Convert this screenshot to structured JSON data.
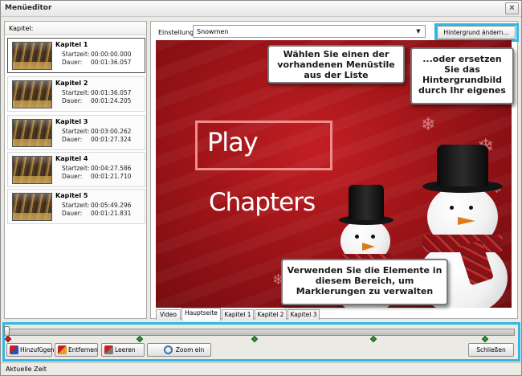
{
  "window": {
    "title": "Menüeditor",
    "close_glyph": "✕"
  },
  "chapters_panel": {
    "header": "Kapitel:",
    "start_label": "Startzeit:",
    "duration_label": "Dauer:",
    "items": [
      {
        "name": "Kapitel 1",
        "start": "00:00:00.000",
        "duration": "00:01:36.057",
        "selected": true
      },
      {
        "name": "Kapitel 2",
        "start": "00:01:36.057",
        "duration": "00:01:24.205",
        "selected": false
      },
      {
        "name": "Kapitel 3",
        "start": "00:03:00.262",
        "duration": "00:01:27.324",
        "selected": false
      },
      {
        "name": "Kapitel 4",
        "start": "00:04:27.586",
        "duration": "00:01:21.710",
        "selected": false
      },
      {
        "name": "Kapitel 5",
        "start": "00:05:49.296",
        "duration": "00:01:21.831",
        "selected": false
      }
    ]
  },
  "settings": {
    "label": "Einstellung",
    "selected_style": "Snowmen",
    "change_background_button": "Hintergrund ändern..."
  },
  "preview": {
    "play_text": "Play",
    "chapters_text": "Chapters"
  },
  "tabs": [
    {
      "label": "Video",
      "active": false
    },
    {
      "label": "Hauptseite",
      "active": true
    },
    {
      "label": "Kapitel 1",
      "active": false
    },
    {
      "label": "Kapitel 2",
      "active": false
    },
    {
      "label": "Kapitel 3",
      "active": false
    }
  ],
  "timeline": {
    "buttons": {
      "add": "Hinzufügen",
      "remove": "Entfernen",
      "clear": "Leeren",
      "zoom": "Zoom ein",
      "close": "Schließen"
    }
  },
  "statusbar": {
    "text": "Aktuelle Zeit"
  },
  "callouts": {
    "style_list": "Wählen Sie einen der vorhandenen Menüstile aus der Liste",
    "background": "...oder ersetzen Sie das Hintergrundbild durch Ihr eigenes",
    "markers": "Verwenden Sie die Elemente in diesem Bereich, um Markierungen zu verwalten"
  },
  "colors": {
    "highlight": "#2fb8e6",
    "marker_green": "#2f8f2f",
    "marker_red": "#cc2020"
  },
  "icons": {
    "close": "close-icon",
    "dropdown": "chevron-down-icon",
    "add": "add-marker-icon",
    "remove": "remove-marker-icon",
    "clear": "clear-markers-icon",
    "zoom": "zoom-in-icon"
  }
}
